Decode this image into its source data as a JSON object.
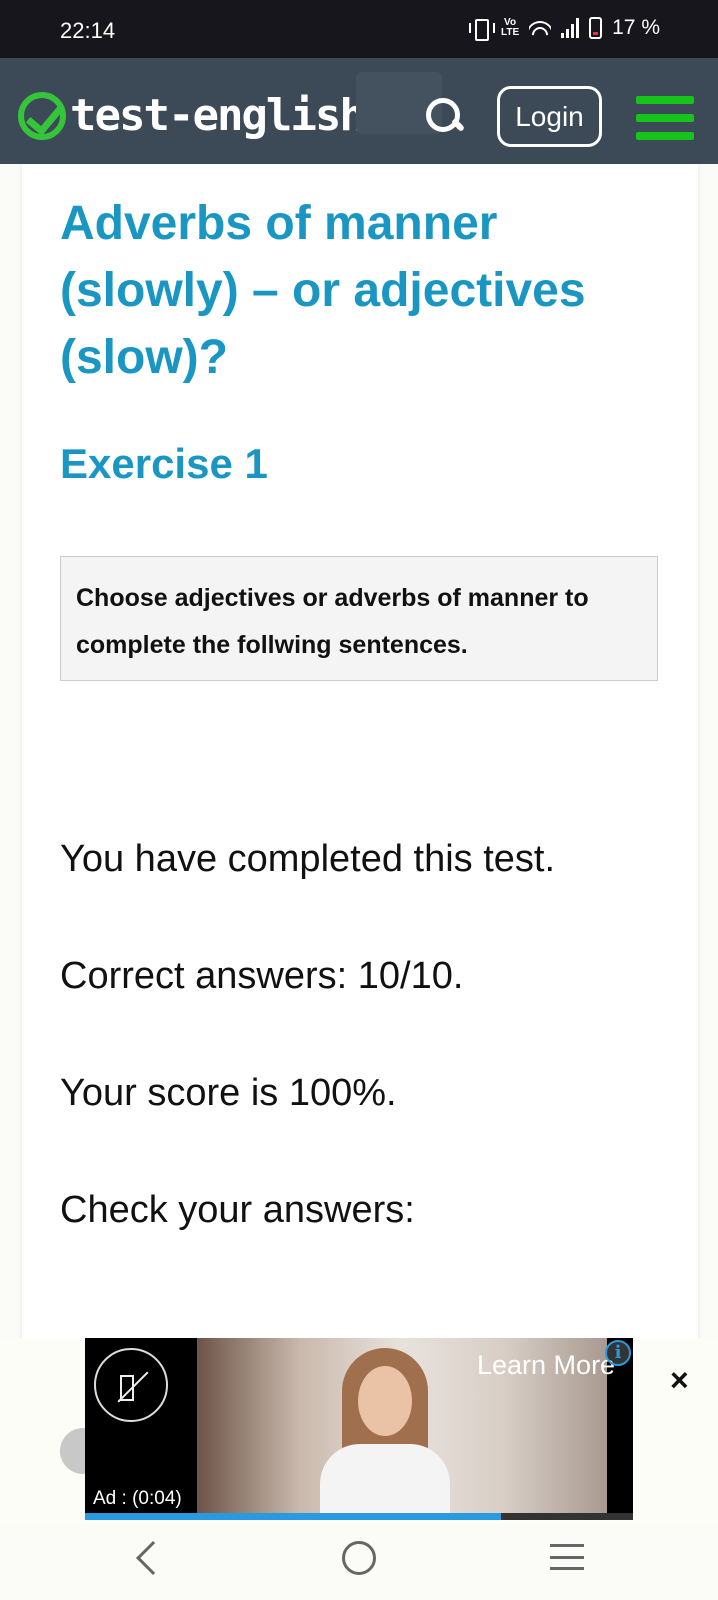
{
  "status_bar": {
    "time": "22:14",
    "network_label": "Vo LTE",
    "battery": "17 %"
  },
  "header": {
    "logo_text": "test-english",
    "login_label": "Login",
    "icons": [
      "check-logo-icon",
      "search-icon",
      "menu-icon"
    ],
    "accent_color": "#17c41c",
    "background_color": "#3c4a57"
  },
  "main": {
    "title": "Adverbs of manner (slowly) – or adjectives (slow)?",
    "subtitle": "Exercise 1",
    "instruction": "Choose adjectives or adverbs of manner to complete the follwing sentences.",
    "title_color": "#1a96c2",
    "results": {
      "completed": "You have completed this test.",
      "correct": "Correct answers: 10/10.",
      "score": "Your score is 100%.",
      "check": "Check your answers:"
    }
  },
  "ad": {
    "label": "Ad : (0:04)",
    "learn_more": "Learn More",
    "info": "i",
    "close": "×",
    "progress": 0.76
  },
  "nav_bar": {
    "icons": [
      "back-icon",
      "home-icon",
      "recent-apps-icon"
    ]
  }
}
